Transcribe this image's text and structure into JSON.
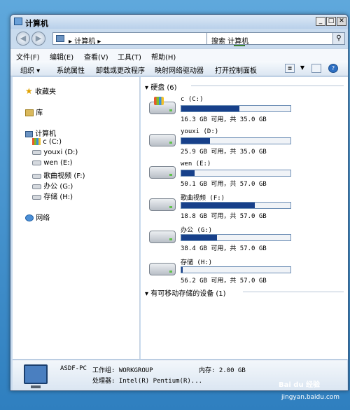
{
  "window": {
    "title": "计算机"
  },
  "address": {
    "path": "▸ 计算机 ▸",
    "search_placeholder": "搜索 计算机"
  },
  "menu": [
    "文件(F)",
    "编辑(E)",
    "查看(V)",
    "工具(T)",
    "帮助(H)"
  ],
  "toolbar": {
    "organize": "组织 ▾",
    "system_props": "系统属性",
    "uninstall": "卸载或更改程序",
    "map_drive": "映射网络驱动器",
    "control_panel": "打开控制面板"
  },
  "sidebar": {
    "favorites": "收藏夹",
    "libraries": "库",
    "computer": "计算机",
    "drives": [
      "c (C:)",
      "youxi (D:)",
      "wen (E:)",
      "歌曲视频 (F:)",
      "办公 (G:)",
      "存储 (H:)"
    ],
    "network": "网络"
  },
  "content": {
    "hdd_group": "硬盘 (6)",
    "removable_group": "有可移动存储的设备 (1)",
    "drives": [
      {
        "name": "c (C:)",
        "used": 0.534,
        "space": "16.3 GB 可用，共 35.0 GB"
      },
      {
        "name": "youxi (D:)",
        "used": 0.26,
        "space": "25.9 GB 可用，共 35.0 GB"
      },
      {
        "name": "wen (E:)",
        "used": 0.12,
        "space": "50.1 GB 可用，共 57.0 GB"
      },
      {
        "name": "歌曲视频 (F:)",
        "used": 0.67,
        "space": "18.8 GB 可用，共 57.0 GB"
      },
      {
        "name": "办公 (G:)",
        "used": 0.33,
        "space": "38.4 GB 可用，共 57.0 GB"
      },
      {
        "name": "存储 (H:)",
        "used": 0.01,
        "space": "56.2 GB 可用，共 57.0 GB"
      }
    ]
  },
  "status": {
    "pc": "ASDF-PC",
    "workgroup": "工作组: WORKGROUP",
    "memory": "内存: 2.00 GB",
    "processor": "处理器: Intel(R) Pentium(R)..."
  },
  "watermark": {
    "text1": "Bai du 经验",
    "text2": "jingyan.baidu.com"
  }
}
